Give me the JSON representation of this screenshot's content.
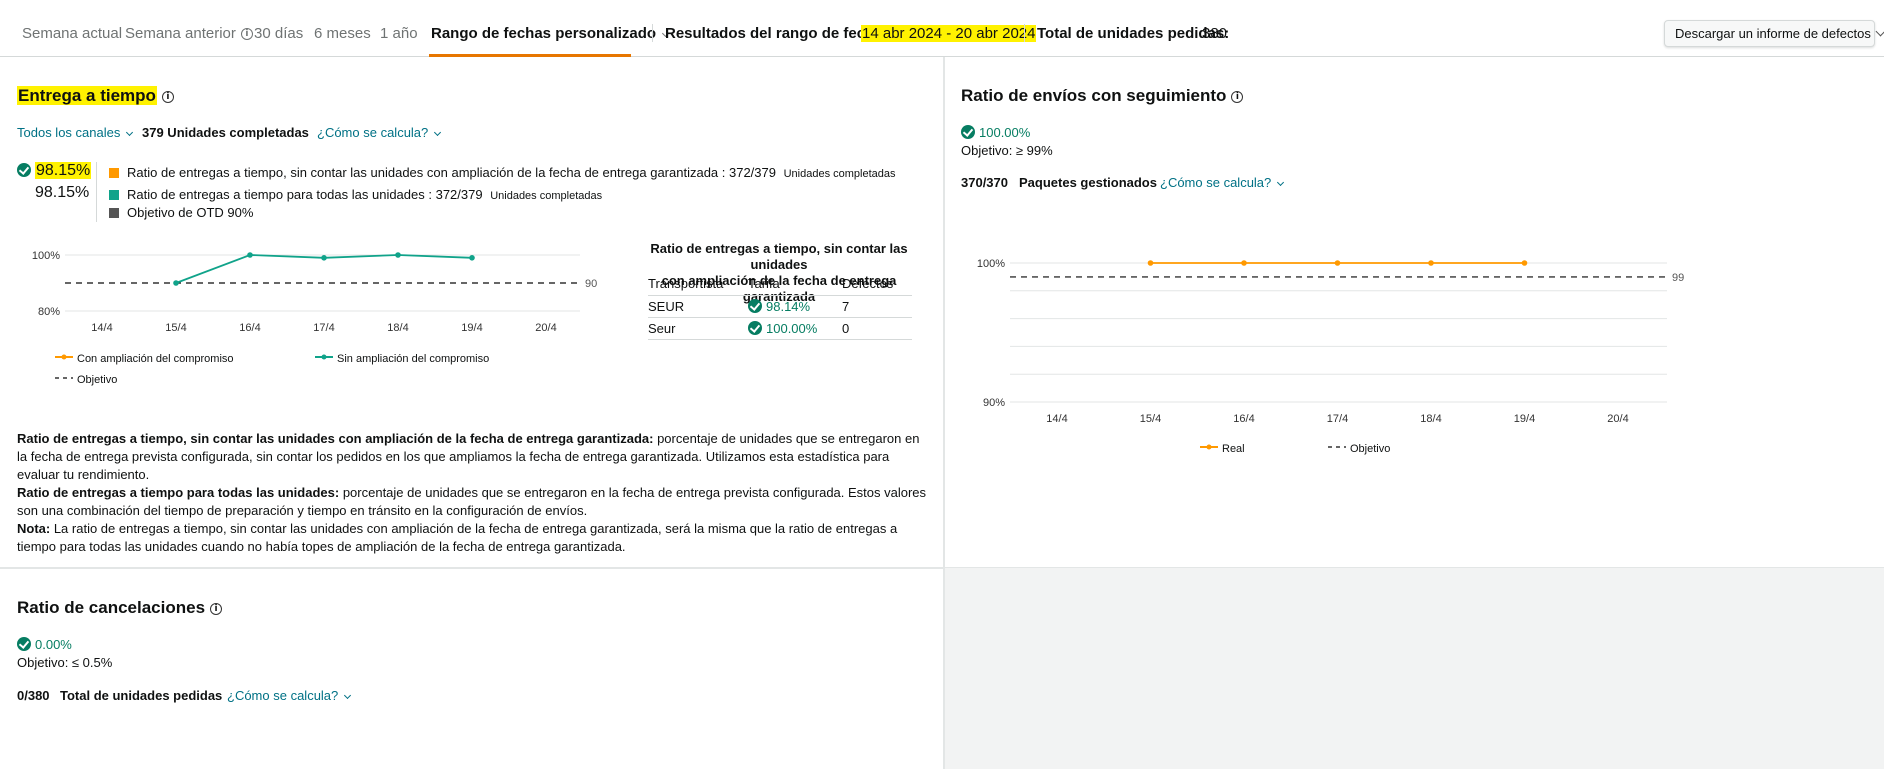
{
  "tabs": [
    {
      "label": "Semana actual"
    },
    {
      "label": "Semana anterior"
    },
    {
      "label": "30 días"
    },
    {
      "label": "6 meses"
    },
    {
      "label": "1 año"
    },
    {
      "label": "Rango de fechas personalizado"
    }
  ],
  "summary": {
    "range_label": "Resultados del rango de fechas::",
    "range_value": "14 abr 2024 - 20 abr 2024",
    "units_label": "Total de unidades pedidas:",
    "units_value": "380"
  },
  "download_button": "Descargar un informe de defectos",
  "otd": {
    "title": "Entrega a tiempo",
    "channel": "Todos los canales",
    "completed": "379 Unidades completadas",
    "how_link": "¿Cómo se calcula?",
    "value1": "98.15%",
    "value2": "98.15%",
    "legend": [
      {
        "text": "Ratio de entregas a tiempo, sin contar las unidades con ampliación de la fecha de entrega garantizada : 372/379",
        "suffix": "Unidades completadas",
        "color": "#ff9900"
      },
      {
        "text": "Ratio de entregas a tiempo para todas las unidades : 372/379",
        "suffix": "Unidades completadas",
        "color": "#10a38a"
      },
      {
        "text": "Objetivo de OTD 90%",
        "suffix": "",
        "color": "#555555"
      }
    ],
    "chart_legend": [
      "Con ampliación del compromiso",
      "Sin ampliación del compromiso",
      "Objetivo"
    ],
    "table": {
      "title_line1": "Ratio de entregas a tiempo, sin contar las unidades",
      "title_line2": "con ampliación de la fecha de entrega garantizada",
      "headers": [
        "Transportista",
        "Tarifa",
        "Defectos"
      ],
      "rows": [
        {
          "carrier": "SEUR",
          "rate": "98.14%",
          "defects": "7"
        },
        {
          "carrier": "Seur",
          "rate": "100.00%",
          "defects": "0"
        }
      ]
    },
    "desc": {
      "p1_bold": "Ratio de entregas a tiempo, sin contar las unidades con ampliación de la fecha de entrega garantizada:",
      "p1_text": " porcentaje de unidades que se entregaron en la fecha de entrega prevista configurada, sin contar los pedidos en los que ampliamos la fecha de entrega garantizada. Utilizamos esta estadística para evaluar tu rendimiento.",
      "p2_bold": "Ratio de entregas a tiempo para todas las unidades:",
      "p2_text": " porcentaje de unidades que se entregaron en la fecha de entrega prevista configurada. Estos valores son una combinación del tiempo de preparación y tiempo en tránsito en la configuración de envíos.",
      "p3_bold": "Nota:",
      "p3_text": " La ratio de entregas a tiempo, sin contar las unidades con ampliación de la fecha de entrega garantizada, será la misma que la ratio de entregas a tiempo para todas las unidades cuando no había topes de ampliación de la fecha de entrega garantizada."
    }
  },
  "tracking": {
    "title": "Ratio de envíos con seguimiento",
    "value": "100.00%",
    "target": "Objetivo: ≥ 99%",
    "packages_count": "370/370",
    "packages_label": "Paquetes gestionados",
    "how_link": "¿Cómo se calcula?",
    "chart_legend": [
      "Real",
      "Objetivo"
    ]
  },
  "cancel": {
    "title": "Ratio de cancelaciones",
    "value": "0.00%",
    "target": "Objetivo: ≤ 0.5%",
    "count": "0/380",
    "label": "Total de unidades pedidas",
    "how_link": "¿Cómo se calcula?"
  },
  "chart_data": [
    {
      "type": "line",
      "x": [
        "14/4",
        "15/4",
        "16/4",
        "17/4",
        "18/4",
        "19/4",
        "20/4"
      ],
      "ylim": [
        80,
        100
      ],
      "yticks": [
        "100%",
        "80%"
      ],
      "target": 90,
      "target_label": "90",
      "series": [
        {
          "name": "Sin ampliación del compromiso",
          "color": "#10a38a",
          "values": [
            null,
            90,
            100,
            99,
            100,
            99,
            null
          ]
        }
      ]
    },
    {
      "type": "line",
      "x": [
        "14/4",
        "15/4",
        "16/4",
        "17/4",
        "18/4",
        "19/4",
        "20/4"
      ],
      "ylim": [
        90,
        100
      ],
      "yticks": [
        "100%",
        "90%"
      ],
      "target": 99,
      "target_label": "99",
      "series": [
        {
          "name": "Real",
          "color": "#ff9900",
          "values": [
            null,
            100,
            100,
            100,
            100,
            100,
            null
          ]
        }
      ]
    }
  ]
}
